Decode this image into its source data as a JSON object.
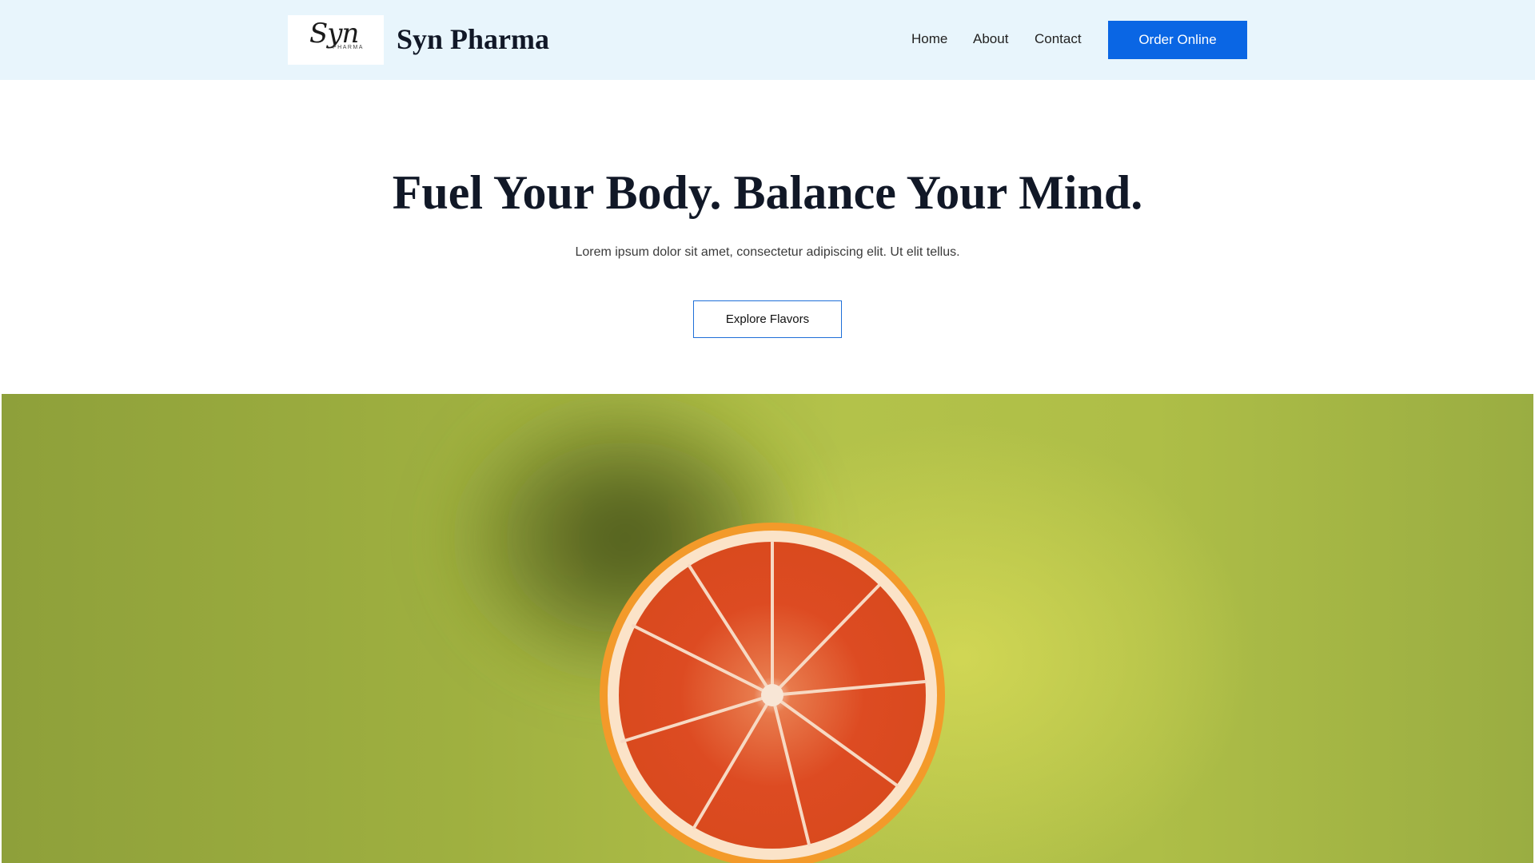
{
  "header": {
    "logo": {
      "script_text": "Syn",
      "sub_text": "PHARMA"
    },
    "brand_name": "Syn Pharma",
    "nav": [
      {
        "label": "Home"
      },
      {
        "label": "About"
      },
      {
        "label": "Contact"
      }
    ],
    "cta_label": "Order Online"
  },
  "hero": {
    "title": "Fuel Your Body. Balance Your Mind.",
    "subtitle": "Lorem ipsum dolor sit amet, consectetur adipiscing elit. Ut elit tellus.",
    "button_label": "Explore Flavors"
  },
  "photo": {
    "subject": "halved-blood-orange-image"
  },
  "colors": {
    "header_bg": "#e8f5fc",
    "accent": "#0a66e4",
    "heading": "#111827",
    "photo_bg": "#a8b944",
    "orange_flesh": "#e0451f",
    "orange_rind": "#f5a02c"
  }
}
